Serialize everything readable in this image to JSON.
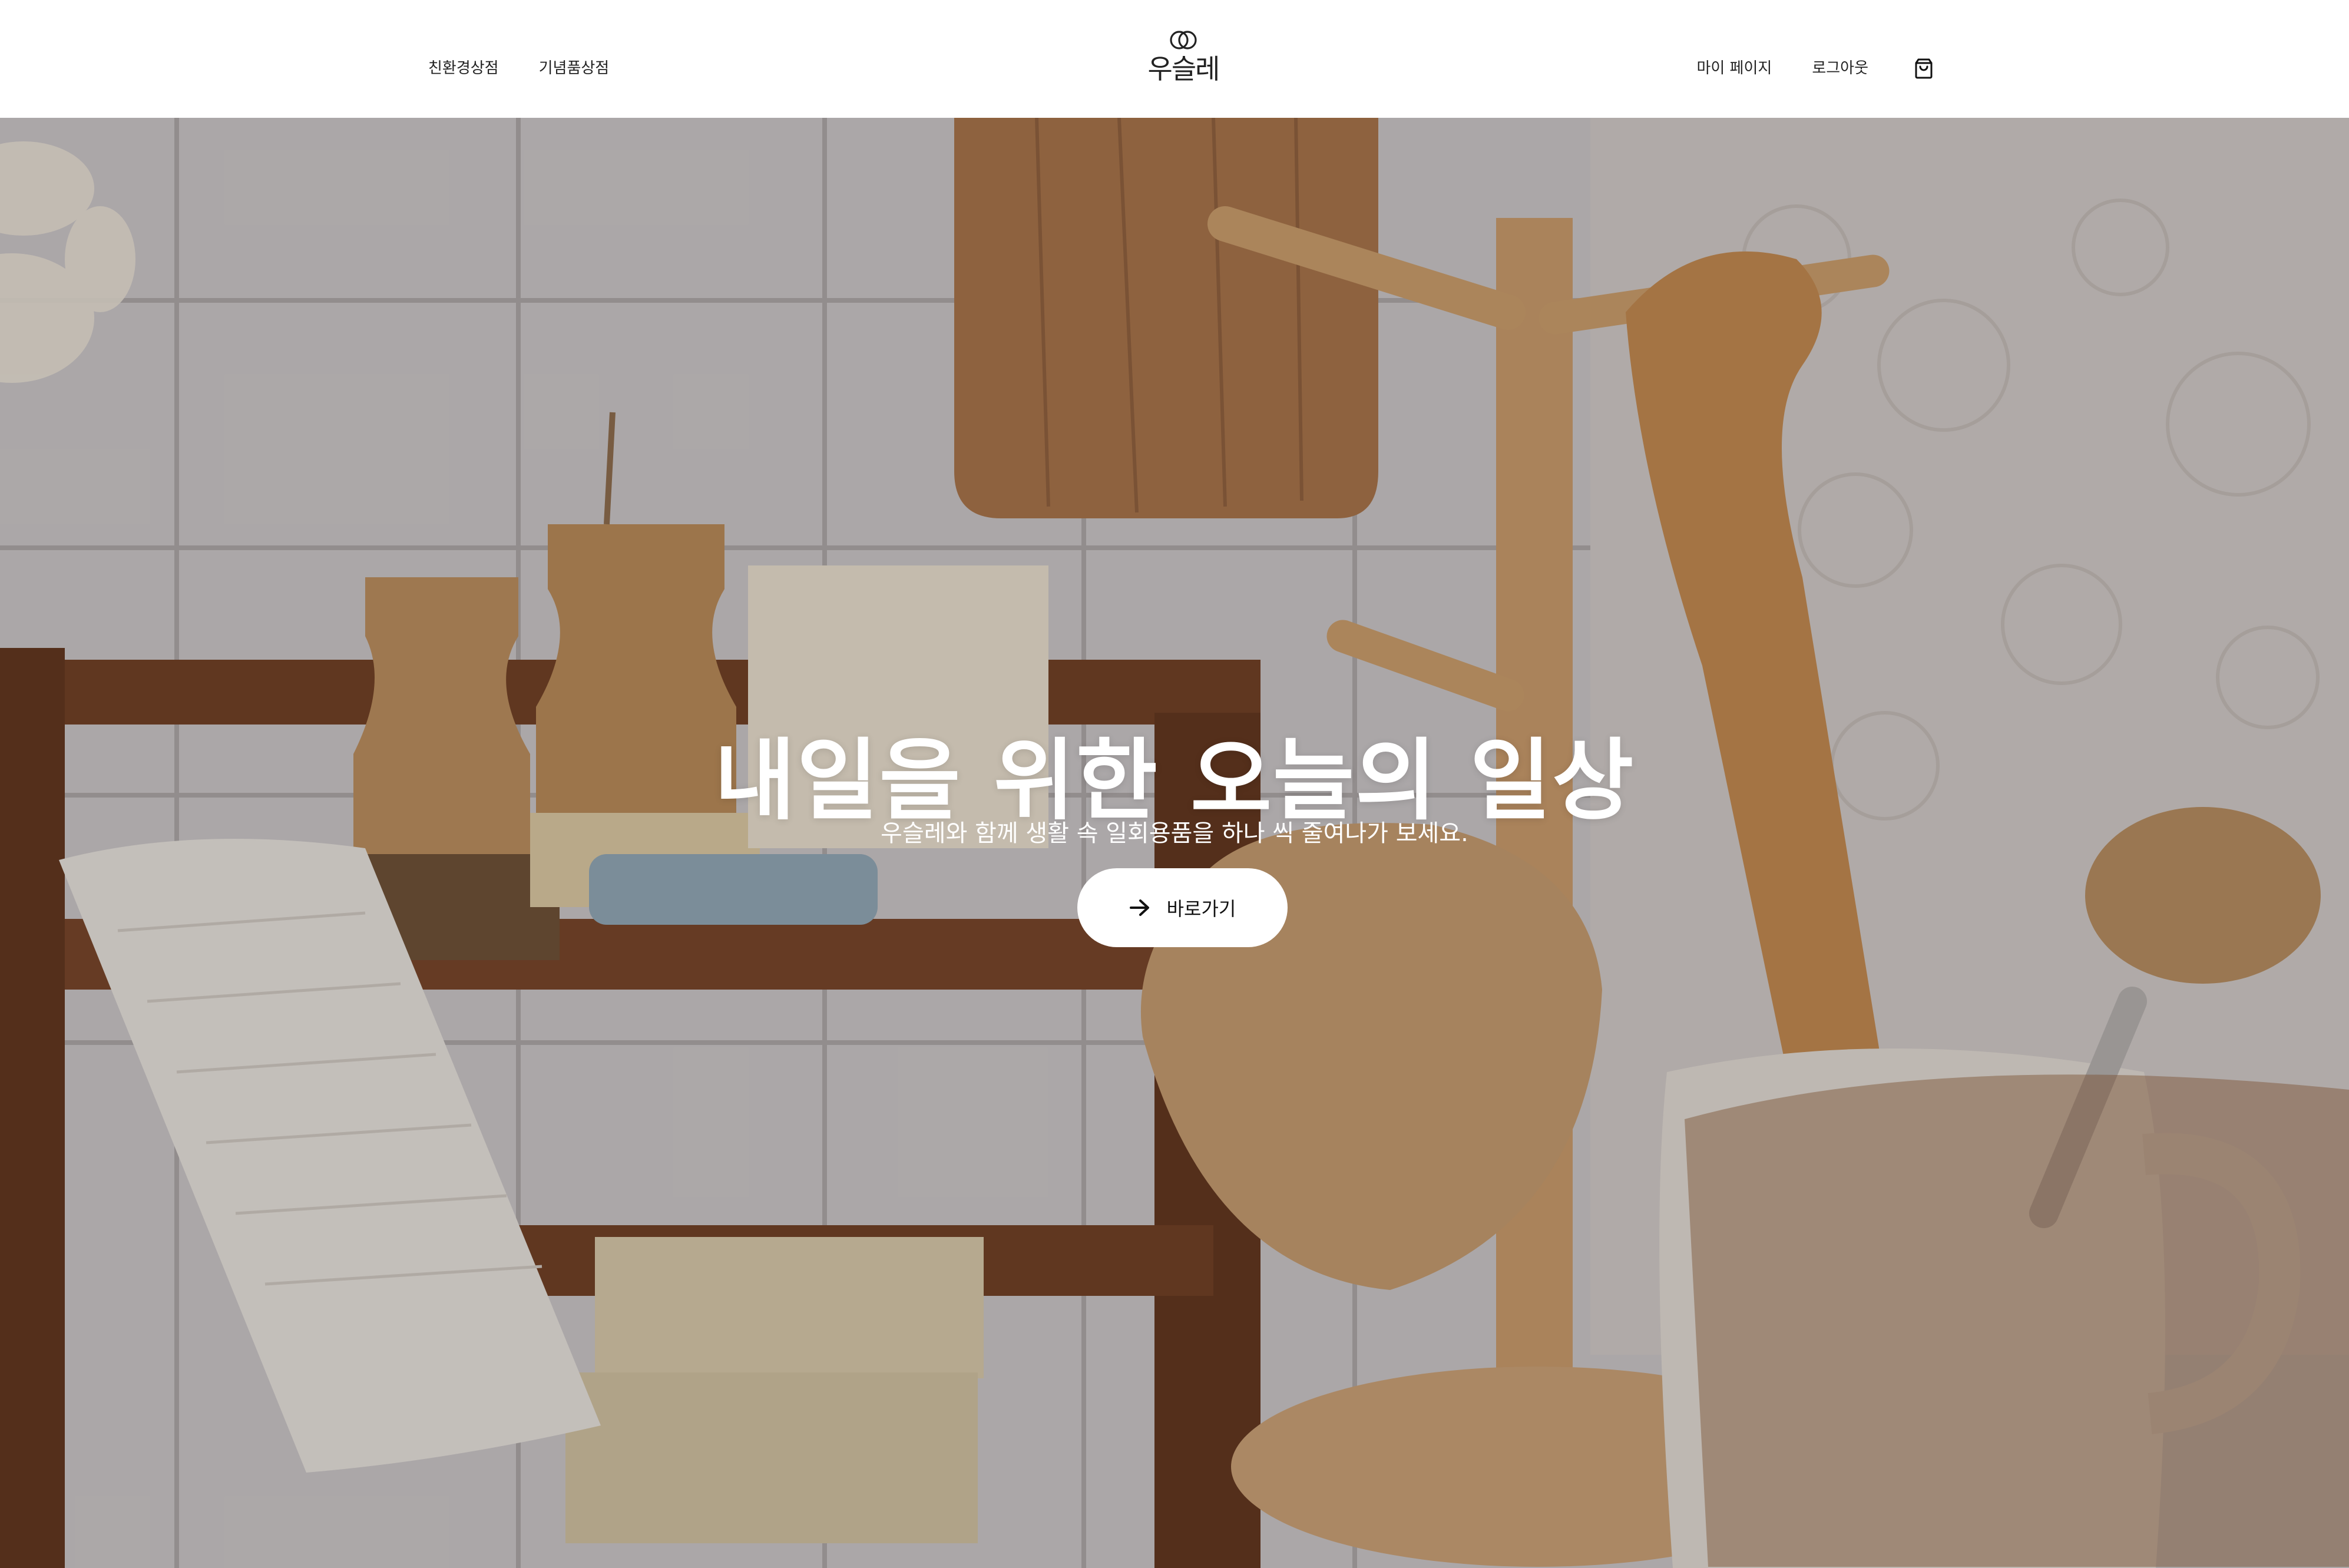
{
  "header": {
    "nav_left": [
      "친환경상점",
      "기념품상점"
    ],
    "logo_text": "우슬레",
    "nav_right": [
      "마이 페이지",
      "로그아웃"
    ],
    "cart_icon": "shopping-bag-icon"
  },
  "hero": {
    "title": "내일을 위한 오늘의 일상",
    "subtitle": "우슬레와 함께 생활 속 일회용품을 하나 씩 줄여나가 보세요.",
    "cta_label": "바로가기",
    "cta_icon": "arrow-right-icon"
  },
  "colors": {
    "header_bg": "#ffffff",
    "text_dark": "#222222",
    "hero_text": "#ffffff",
    "button_bg": "#ffffff"
  }
}
